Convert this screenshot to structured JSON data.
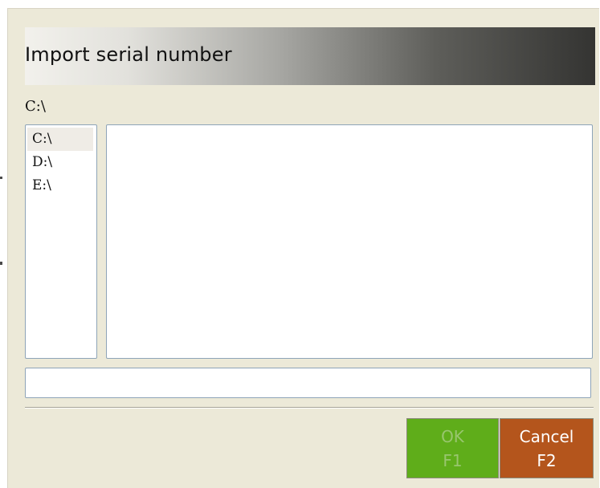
{
  "dialog": {
    "title": "Import serial number",
    "current_path": "C:\\"
  },
  "drives": [
    {
      "label": "C:\\",
      "selected": true
    },
    {
      "label": "D:\\",
      "selected": false
    },
    {
      "label": "E:\\",
      "selected": false
    }
  ],
  "files": [],
  "filename_input": {
    "value": "",
    "placeholder": ""
  },
  "buttons": {
    "ok_label": "OK",
    "ok_key": "F1",
    "ok_enabled": false,
    "cancel_label": "Cancel",
    "cancel_key": "F2"
  },
  "colors": {
    "ok_button": "#5fad1a",
    "cancel_button": "#b4551c",
    "dialog_background": "#ece9d8"
  }
}
